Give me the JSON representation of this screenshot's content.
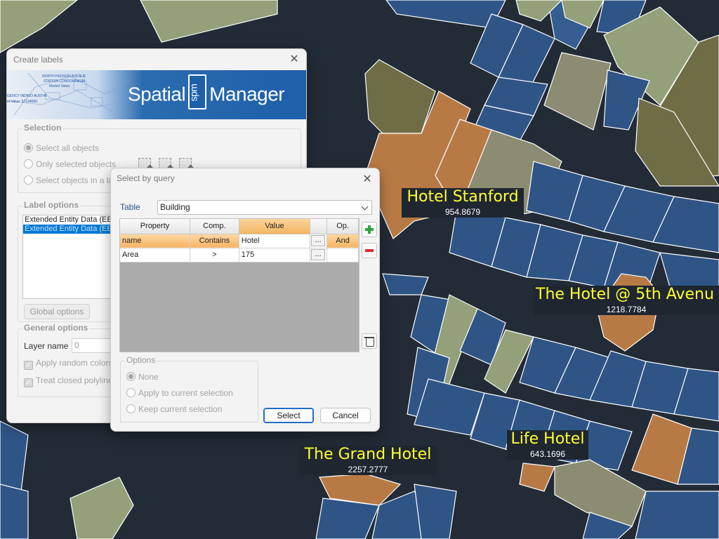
{
  "map": {
    "labels": [
      {
        "name": "Hotel Stanford",
        "value": "954.8679"
      },
      {
        "name": "The Hotel @ 5th Avenu",
        "value": "1218.7784"
      },
      {
        "name": "Life Hotel",
        "value": "643.1696"
      },
      {
        "name": "The Grand Hotel",
        "value": "2257.2777"
      }
    ],
    "colors": {
      "background": "#222b36",
      "building": "#2f5586",
      "building_alt": "#355d90",
      "highlight": "#b87a45",
      "park": "#94a079",
      "olive": "#6f6d46",
      "khaki": "#8c8c72"
    }
  },
  "create_labels": {
    "title": "Create labels",
    "close_icon": "close-icon",
    "banner": {
      "brand_left": "Spatial",
      "brand_box": "spm",
      "brand_right": "Manager",
      "mini_lines": [
        "NORTH HUDSON AVENUE",
        "STATION CONDOMINIUM",
        "Market Value:",
        "GENCY INDIGO AUSTIN",
        "et Value: 57124000"
      ]
    },
    "selection": {
      "title": "Selection",
      "options": [
        "Select all objects",
        "Only selected objects",
        "Select objects in a lay"
      ]
    },
    "label_options": {
      "title": "Label options",
      "list": [
        "Extended Entity Data (EED",
        "Extended Entity Data (EED"
      ],
      "global_button": "Global options"
    },
    "general_options": {
      "title": "General options",
      "layer_label": "Layer name",
      "layer_value": "0",
      "checks": [
        "Apply random colors t",
        "Treat closed polylines"
      ]
    }
  },
  "select_query": {
    "title": "Select by query",
    "close_icon": "close-icon",
    "table_label": "Table",
    "table_value": "Building",
    "columns": [
      "Property",
      "Comp.",
      "Value",
      "Op."
    ],
    "rows": [
      {
        "property": "name",
        "comp": "Contains",
        "value": "Hotel",
        "op": "And"
      },
      {
        "property": "Area",
        "comp": ">",
        "value": "175",
        "op": ""
      }
    ],
    "ellipsis": "...",
    "options": {
      "title": "Options",
      "items": [
        "None",
        "Apply to current selection",
        "Keep current selection"
      ]
    },
    "select_button": "Select",
    "cancel_button": "Cancel"
  }
}
